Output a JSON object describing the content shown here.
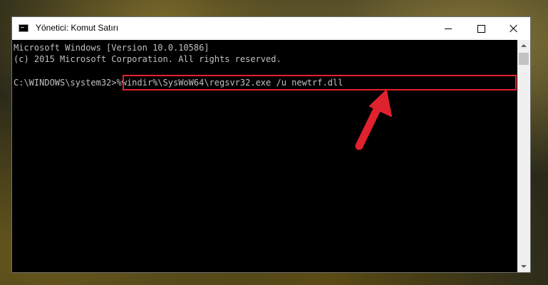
{
  "window": {
    "title": "Yönetici: Komut Satırı",
    "controls": {
      "minimize_icon": "minimize-icon",
      "maximize_icon": "maximize-icon",
      "close_icon": "close-icon"
    }
  },
  "console": {
    "lines": [
      "Microsoft Windows [Version 10.0.10586]",
      "(c) 2015 Microsoft Corporation. All rights reserved."
    ],
    "prompt": "C:\\WINDOWS\\system32>",
    "command": "%windir%\\SysWoW64\\regsvr32.exe /u newtrf.dll"
  },
  "annotation": {
    "highlight_color": "#e0212e",
    "arrow_color": "#e0212e"
  },
  "colors": {
    "console_background": "#000000",
    "console_text": "#c0c0c0",
    "titlebar": "#ffffff"
  }
}
